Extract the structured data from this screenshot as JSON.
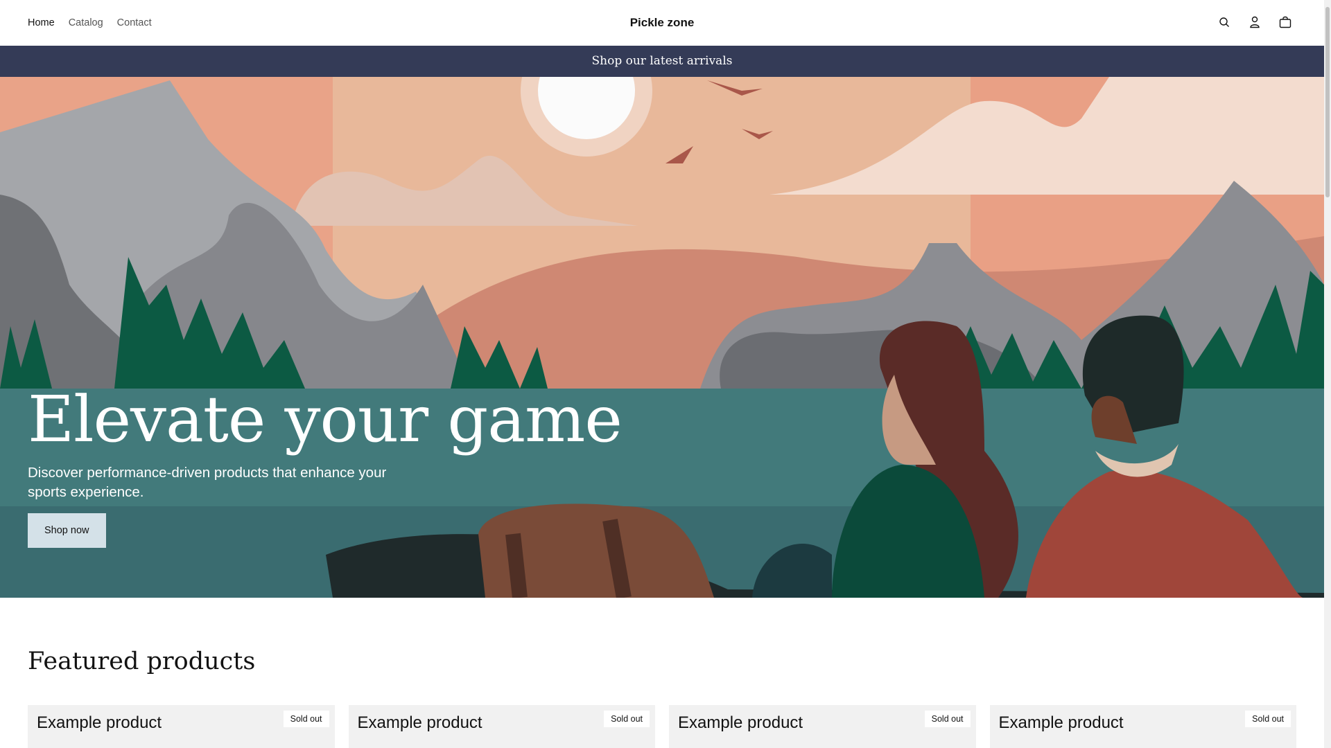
{
  "header": {
    "nav": [
      "Home",
      "Catalog",
      "Contact"
    ],
    "brand": "Pickle zone",
    "icons": [
      "search-icon",
      "account-icon",
      "cart-icon"
    ]
  },
  "announcement": "Shop our latest arrivals",
  "hero": {
    "title": "Elevate your game",
    "subtitle": "Discover performance-driven products that enhance your sports experience.",
    "button": "Shop now"
  },
  "featured": {
    "heading": "Featured products",
    "products": [
      {
        "title": "Example product",
        "badge": "Sold out"
      },
      {
        "title": "Example product",
        "badge": "Sold out"
      },
      {
        "title": "Example product",
        "badge": "Sold out"
      },
      {
        "title": "Example product",
        "badge": "Sold out"
      }
    ]
  },
  "colors": {
    "announcement_bg": "#343b57",
    "button_bg": "#d4e1e8",
    "card_bg": "#f1f1f1"
  }
}
